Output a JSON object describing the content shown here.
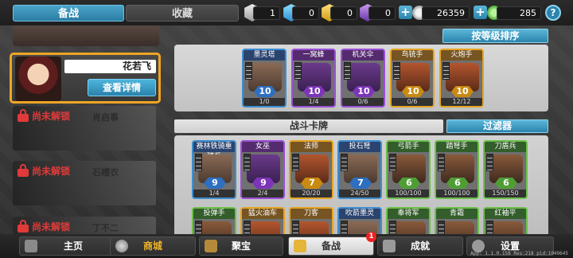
{
  "tabs": {
    "prepare": "备战",
    "collection": "收藏"
  },
  "resources": {
    "silver_gem": "1",
    "blue_gem": "0",
    "gold_gem": "0",
    "purple_gem": "0",
    "gold_coins": "26359",
    "green_coins": "285"
  },
  "help_label": "?",
  "heroes": {
    "active_name": "花若飞",
    "detail_button": "查看详情",
    "locked_label": "尚未解锁",
    "locked_ghosts": [
      "肖启事",
      "石槽衣",
      "丁不二"
    ]
  },
  "sort_button": "按等级排序",
  "deck_cards": [
    {
      "name": "墨灵塔",
      "level": "10",
      "count": "1/0",
      "rarity": "blue"
    },
    {
      "name": "一窝蜂",
      "level": "10",
      "count": "1/4",
      "rarity": "purple"
    },
    {
      "name": "机关伞",
      "level": "10",
      "count": "0/6",
      "rarity": "purple"
    },
    {
      "name": "鸟铳手",
      "level": "10",
      "count": "0/6",
      "rarity": "gold"
    },
    {
      "name": "火炮手",
      "level": "10",
      "count": "12/12",
      "rarity": "gold"
    }
  ],
  "section_title": "战斗卡牌",
  "filter_button": "过滤器",
  "card_rows": [
    [
      {
        "name": "赛林铁骑重骑兵",
        "level": "9",
        "count": "1/4",
        "rarity": "blue"
      },
      {
        "name": "女巫",
        "level": "9",
        "count": "2/4",
        "rarity": "purple"
      },
      {
        "name": "法师",
        "level": "7",
        "count": "20/20",
        "rarity": "gold"
      },
      {
        "name": "投石弩",
        "level": "7",
        "count": "24/50",
        "rarity": "blue"
      },
      {
        "name": "弓箭手",
        "level": "6",
        "count": "100/100",
        "rarity": "green"
      },
      {
        "name": "踏弩手",
        "level": "6",
        "count": "100/100",
        "rarity": "green"
      },
      {
        "name": "刀盾兵",
        "level": "6",
        "count": "150/150",
        "rarity": "green"
      }
    ],
    [
      {
        "name": "投弹手",
        "level": "",
        "count": "",
        "rarity": "green"
      },
      {
        "name": "猛火油车",
        "level": "",
        "count": "",
        "rarity": "gold"
      },
      {
        "name": "刀客",
        "level": "",
        "count": "",
        "rarity": "gold"
      },
      {
        "name": "吹箭墨灵",
        "level": "",
        "count": "",
        "rarity": "blue"
      },
      {
        "name": "奉将军",
        "level": "",
        "count": "",
        "rarity": "green"
      },
      {
        "name": "青霜",
        "level": "",
        "count": "",
        "rarity": "green"
      },
      {
        "name": "红袖平",
        "level": "",
        "count": "",
        "rarity": "green"
      }
    ]
  ],
  "bottom_nav": {
    "home": "主页",
    "shop": "商城",
    "treasure": "聚宝",
    "prepare": "备战",
    "achievements": "成就",
    "settings": "设置",
    "notification_count": "1"
  },
  "version_text": "App: 1.1.0.158 Res:218 pid:1049645",
  "colors": {
    "accent_blue": "#2b84ad",
    "gold_border": "#f0a524",
    "locked_red": "#e03a3a"
  }
}
